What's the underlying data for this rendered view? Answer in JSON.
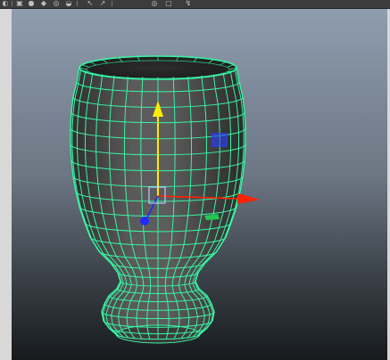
{
  "app": {
    "window": "Maya viewport"
  },
  "toolbar": {
    "icons": [
      "select-icon",
      "lasso-icon",
      "paint-icon",
      "move-icon",
      "rotate-icon",
      "scale-icon",
      "last-tool-icon",
      "show-manipulator-icon",
      "render-icon",
      "ipr-icon",
      "render-settings-icon"
    ]
  },
  "viewport": {
    "background_top": "#8e9daf",
    "background_bottom": "#161a1d",
    "mesh_color": "#39f5a5",
    "selected_object": "goblet-mesh",
    "manipulator": {
      "y_axis_color": "#ffee00",
      "x_axis_color": "#ff2200",
      "z_axis_color": "#1f2bff",
      "xy_plane_handle_color": "#2a3cff",
      "xz_plane_handle_color": "#22c850"
    }
  }
}
